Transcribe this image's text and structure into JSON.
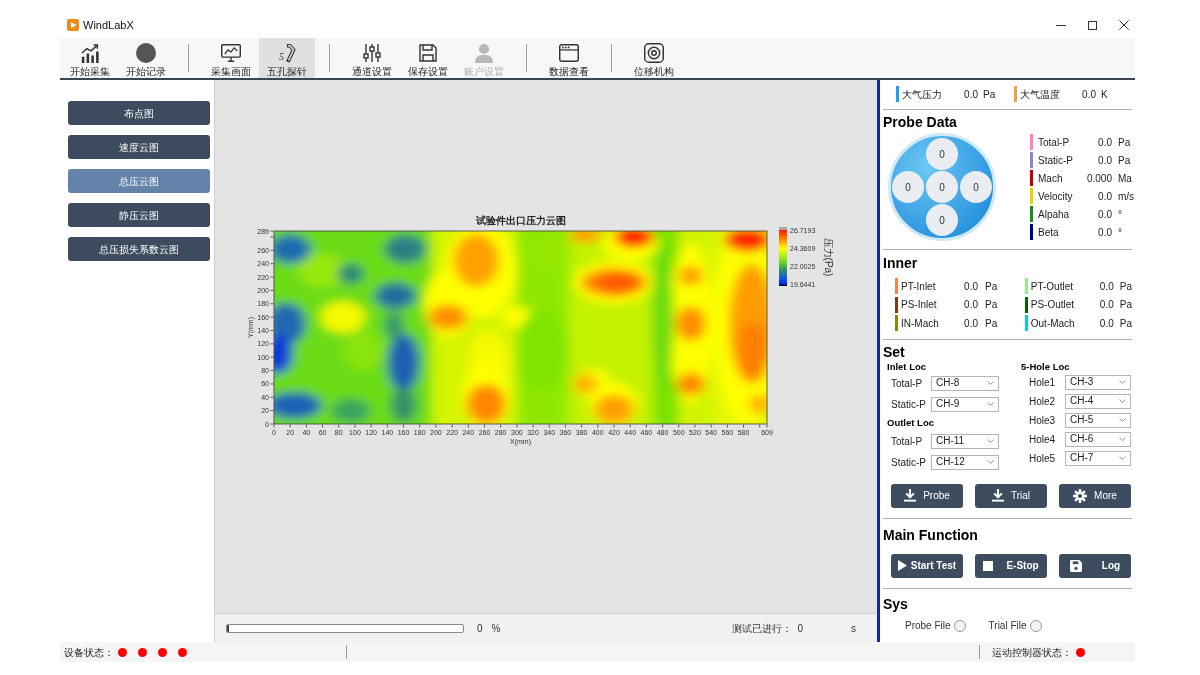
{
  "window": {
    "title": "WindLabX"
  },
  "toolbar": {
    "groups": [
      {
        "items": [
          {
            "label": "开始采集",
            "selected": false,
            "disabled": false
          },
          {
            "label": "开始记录",
            "selected": false,
            "disabled": false
          }
        ]
      },
      {
        "items": [
          {
            "label": "采集画面",
            "selected": false,
            "disabled": false
          },
          {
            "label": "五孔探针",
            "icon_text": "5",
            "selected": true,
            "disabled": false
          }
        ]
      },
      {
        "items": [
          {
            "label": "通道设置",
            "selected": false,
            "disabled": false
          },
          {
            "label": "保存设置",
            "selected": false,
            "disabled": false
          },
          {
            "label": "账户设置",
            "selected": false,
            "disabled": true
          }
        ]
      },
      {
        "items": [
          {
            "label": "数据查看",
            "selected": false,
            "disabled": false
          }
        ]
      },
      {
        "items": [
          {
            "label": "位移机构",
            "selected": false,
            "disabled": false
          }
        ]
      }
    ]
  },
  "sidebar": {
    "items": [
      {
        "label": "布点图",
        "selected": false
      },
      {
        "label": "速度云图",
        "selected": false
      },
      {
        "label": "总压云图",
        "selected": true
      },
      {
        "label": "静压云图",
        "selected": false
      },
      {
        "label": "总压损失系数云图",
        "selected": false
      }
    ]
  },
  "chart": {
    "title": "试验件出口压力云图",
    "x_label": "X(mm)",
    "y_label": "Y(mm)",
    "x_ticks": [
      "0",
      "20",
      "40",
      "60",
      "80",
      "100",
      "120",
      "140",
      "160",
      "180",
      "200",
      "220",
      "240",
      "260",
      "280",
      "300",
      "320",
      "340",
      "360",
      "380",
      "400",
      "420",
      "440",
      "460",
      "480",
      "500",
      "520",
      "540",
      "560",
      "580",
      "609"
    ],
    "y_ticks": [
      "289",
      "260",
      "240",
      "220",
      "200",
      "180",
      "160",
      "140",
      "120",
      "100",
      "80",
      "60",
      "40",
      "20",
      "0"
    ],
    "color_scale": {
      "title": "压力(Pa)",
      "labels": [
        "26.7193",
        "24.3609",
        "22.0025",
        "19.6441"
      ]
    }
  },
  "progress": {
    "level": 0,
    "percent": "0",
    "percent_sign": "%",
    "elapsed_label": "测试已进行：",
    "elapsed": "0",
    "elapsed_unit": "s"
  },
  "ambient": [
    {
      "label": "大气压力",
      "value": "0.0",
      "unit": "Pa",
      "color": "#1e9fe8"
    },
    {
      "label": "大气温度",
      "value": "0.0",
      "unit": "K",
      "color": "#f5a04a"
    }
  ],
  "probe_data": {
    "title": "Probe Data",
    "holes": [
      {
        "value": "0"
      },
      {
        "value": "0"
      },
      {
        "value": "0"
      },
      {
        "value": "0"
      },
      {
        "value": "0"
      }
    ],
    "readings": [
      {
        "label": "Total-P",
        "value": "0.0",
        "unit": "Pa",
        "color": "#ff80c0"
      },
      {
        "label": "Static-P",
        "value": "0.0",
        "unit": "Pa",
        "color": "#8c86c8"
      },
      {
        "label": "Mach",
        "value": "0.000",
        "unit": "Ma",
        "color": "#c00000"
      },
      {
        "label": "Velocity",
        "value": "0.0",
        "unit": "m/s",
        "color": "#e0d800"
      },
      {
        "label": "Alpaha",
        "value": "0.0",
        "unit": "°",
        "color": "#1a8a1a"
      },
      {
        "label": "Beta",
        "value": "0.0",
        "unit": "°",
        "color": "#00008b"
      }
    ]
  },
  "inner": {
    "title": "Inner",
    "columns": [
      {
        "readings": [
          {
            "label": "PT-Inlet",
            "value": "0.0",
            "unit": "Pa",
            "color": "#ff8040"
          },
          {
            "label": "PS-Inlet",
            "value": "0.0",
            "unit": "Pa",
            "color": "#7a3c10"
          },
          {
            "label": "IN-Mach",
            "value": "0.0",
            "unit": "Pa",
            "color": "#8a8a00"
          }
        ]
      },
      {
        "readings": [
          {
            "label": "PT-Outlet",
            "value": "0.0",
            "unit": "Pa",
            "color": "#90ee90"
          },
          {
            "label": "PS-Outlet",
            "value": "0.0",
            "unit": "Pa",
            "color": "#006400"
          },
          {
            "label": "Out-Mach",
            "value": "0.0",
            "unit": "Pa",
            "color": "#00d0d8"
          }
        ]
      }
    ]
  },
  "set": {
    "title": "Set",
    "inlet_loc": {
      "title": "Inlet Loc",
      "fields": [
        {
          "label": "Total-P",
          "value": "CH-8"
        },
        {
          "label": "Static-P",
          "value": "CH-9"
        }
      ]
    },
    "outlet_loc": {
      "title": "Outlet Loc",
      "fields": [
        {
          "label": "Total-P",
          "value": "CH-11"
        },
        {
          "label": "Static-P",
          "value": "CH-12"
        }
      ]
    },
    "hole_loc": {
      "title": "5-Hole Loc",
      "fields": [
        {
          "label": "Hole1",
          "value": "CH-3"
        },
        {
          "label": "Hole2",
          "value": "CH-4"
        },
        {
          "label": "Hole3",
          "value": "CH-5"
        },
        {
          "label": "Hole4",
          "value": "CH-6"
        },
        {
          "label": "Hole5",
          "value": "CH-7"
        }
      ]
    },
    "buttons": [
      {
        "label": "Probe"
      },
      {
        "label": "Trial"
      },
      {
        "label": "More"
      }
    ]
  },
  "main_function": {
    "title": "Main Function",
    "buttons": [
      {
        "label": "Start Test"
      },
      {
        "label": "E-Stop"
      },
      {
        "label": "Log"
      }
    ]
  },
  "sys": {
    "title": "Sys",
    "options": [
      {
        "label": "Probe File",
        "selected": false
      },
      {
        "label": "Trial File",
        "selected": false
      }
    ]
  },
  "status_bar": {
    "device_status": {
      "label": "设备状态：",
      "indicators": [
        {
          "color": "#ff0000"
        },
        {
          "color": "#ff0000"
        },
        {
          "color": "#ff0000"
        },
        {
          "color": "#ff0000"
        }
      ]
    },
    "controller_status": {
      "label": "运动控制器状态：",
      "indicators": [
        {
          "color": "#ff0000"
        }
      ]
    }
  }
}
